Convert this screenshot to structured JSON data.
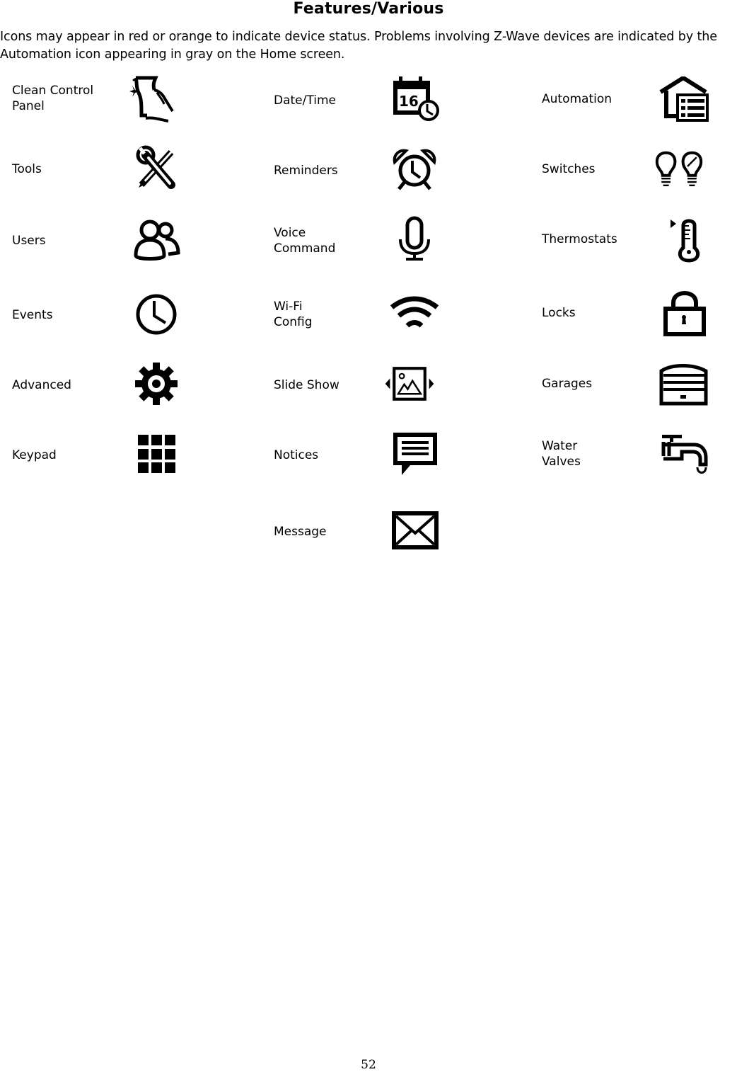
{
  "title": "Features/Various",
  "intro": "Icons  may appear in red or orange to indicate device status. Problems involving Z-Wave devices are indicated by the Automation icon appearing in gray on the Home screen.",
  "columns": [
    {
      "items": [
        {
          "label": "Clean Control\nPanel",
          "icon": "clean-panel-icon"
        },
        {
          "label": "Tools",
          "icon": "tools-icon"
        },
        {
          "label": "Users",
          "icon": "users-icon"
        },
        {
          "label": "Events",
          "icon": "clock-icon"
        },
        {
          "label": "Advanced",
          "icon": "gear-icon"
        },
        {
          "label": "Keypad",
          "icon": "keypad-icon"
        }
      ]
    },
    {
      "items": [
        {
          "label": "Date/Time",
          "icon": "calendar-clock-icon",
          "icon_text": "16"
        },
        {
          "label": "Reminders",
          "icon": "alarm-clock-icon"
        },
        {
          "label": "Voice\nCommand",
          "icon": "microphone-icon"
        },
        {
          "label": "Wi-Fi\nConfig",
          "icon": "wifi-icon"
        },
        {
          "label": "Slide Show",
          "icon": "slideshow-icon"
        },
        {
          "label": "Notices",
          "icon": "speech-bubble-icon"
        },
        {
          "label": "Message",
          "icon": "envelope-icon"
        }
      ]
    },
    {
      "items": [
        {
          "label": "Automation",
          "icon": "home-automation-icon"
        },
        {
          "label": "Switches",
          "icon": "light-bulbs-icon"
        },
        {
          "label": "Thermostats",
          "icon": "thermometer-icon"
        },
        {
          "label": "Locks",
          "icon": "padlock-icon"
        },
        {
          "label": "Garages",
          "icon": "garage-door-icon"
        },
        {
          "label": "Water\nValves",
          "icon": "water-faucet-icon"
        }
      ]
    }
  ],
  "page_number": "52"
}
